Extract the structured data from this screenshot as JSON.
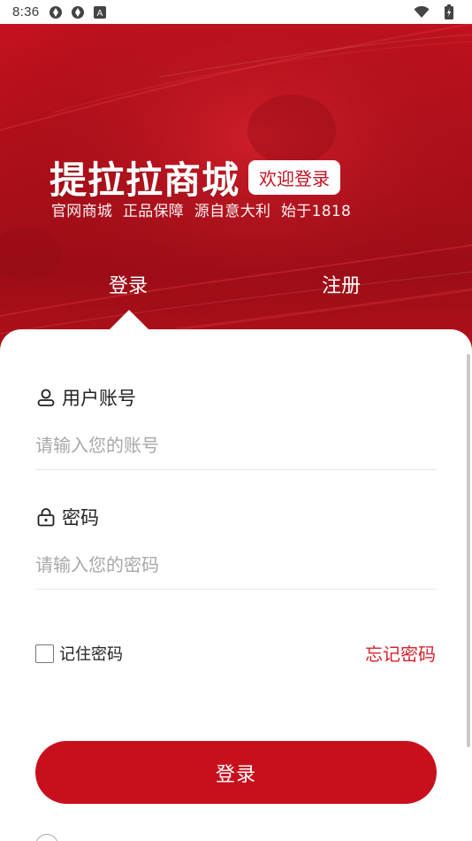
{
  "status_bar": {
    "time": "8:36",
    "icons": [
      "app-notification-icon",
      "app-notification-icon",
      "text-a-icon",
      "wifi-icon",
      "battery-icon"
    ]
  },
  "hero": {
    "brand_title": "提拉拉商城",
    "welcome_badge": "欢迎登录",
    "slogan": "官网商城 正品保障 源自意大利 始于1818",
    "tabs": [
      {
        "label": "登录",
        "active": true
      },
      {
        "label": "注册",
        "active": false
      }
    ],
    "colors": {
      "primary": "#c4121f",
      "dark": "#9d0d17"
    }
  },
  "form": {
    "account": {
      "label": "用户账号",
      "icon": "user-icon",
      "placeholder": "请输入您的账号",
      "value": ""
    },
    "password": {
      "label": "密码",
      "icon": "lock-icon",
      "placeholder": "请输入您的密码",
      "value": ""
    },
    "remember_label": "记住密码",
    "remember_checked": false,
    "forgot_label": "忘记密码",
    "submit_label": "登录",
    "accent_color": "#d7212b"
  }
}
